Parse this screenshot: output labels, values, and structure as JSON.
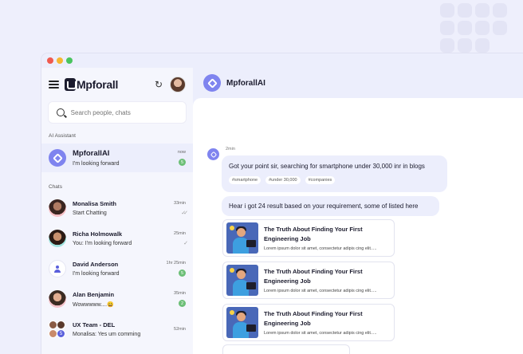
{
  "brand": {
    "name": "Mpforall"
  },
  "search": {
    "placeholder": "Search people, chats"
  },
  "sidebar": {
    "ai_section_label": "AI Assistant",
    "chats_section_label": "Chats",
    "ai_item": {
      "name": "MpforallAI",
      "message": "I'm looking forward",
      "time": "now",
      "badge": "5"
    },
    "chats": [
      {
        "name": "Monalisa Smith",
        "message": "Start Chatting",
        "time": "33min",
        "status": "read"
      },
      {
        "name": "Richa Holmowalk",
        "message": "You: I'm looking forward",
        "time": "25min",
        "status": "read"
      },
      {
        "name": "David Anderson",
        "message": "I'm looking forward",
        "time": "1hr 25min",
        "badge": "5"
      },
      {
        "name": "Alan Benjamin",
        "message": "Wowwwww....😀",
        "time": "35min",
        "badge": "2"
      },
      {
        "name": "UX Team - DEL",
        "message": "Monalisa: Yes um comming",
        "time": "52min",
        "group_count": "5"
      }
    ]
  },
  "conversation": {
    "title": "MpforallAI",
    "time": "2min",
    "bot_message": "Got your point sir, searching for smartphone under 30,000 inr in blogs",
    "tags": [
      "#smartphone",
      "#under 30,000",
      "#companies"
    ],
    "result_message": "Hear i got 24 result based on your requirement, some of listed here",
    "cards": [
      {
        "title": "The Truth About Finding Your First Engineering Job",
        "desc": "Lorem ipsum dolor sit amet, consectetur adipis cing elit....."
      },
      {
        "title": "The Truth About Finding Your First Engineering Job",
        "desc": "Lorem ipsum dolor sit amet, consectetur adipis cing elit....."
      },
      {
        "title": "The Truth About Finding Your First Engineering Job",
        "desc": "Lorem ipsum dolor sit amet, consectetur adipis cing elit....."
      }
    ]
  },
  "colors": {
    "accent": "#7f84ef",
    "badge": "#6cbf77",
    "background": "#eceefc"
  }
}
